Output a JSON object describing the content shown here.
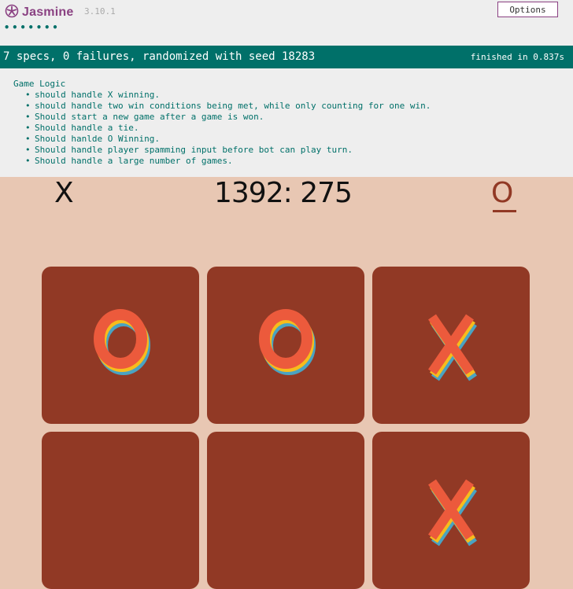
{
  "jasmine": {
    "logo_text": "Jasmine",
    "version": "3.10.1",
    "options_label": "Options",
    "spec_dots": "•••••••",
    "summary": "7 specs, 0 failures, randomized with seed 18283",
    "duration": "finished in 0.837s",
    "suite": {
      "name": "Game Logic",
      "specs": [
        "should handle X winning.",
        "should handle two win conditions being met, while only counting for one win.",
        "Should start a new game after a game is won.",
        "Should handle a tie.",
        "Should hanlde O Winning.",
        "Should handle player spamming input before bot can play turn.",
        "Should handle a large number of games."
      ]
    },
    "colors": {
      "brand": "#8a4182",
      "pass": "#007069"
    }
  },
  "game": {
    "player_x": "X",
    "player_o": "O",
    "score": "1392: 275",
    "current_turn": "O",
    "board": [
      "O",
      "O",
      "X",
      "",
      "",
      "X"
    ],
    "colors": {
      "background": "#e8c7b3",
      "cell": "#913925",
      "mark_red": "#ec5a3c",
      "mark_yellow": "#f7bc1c",
      "mark_blue": "#4aa3c2"
    }
  }
}
